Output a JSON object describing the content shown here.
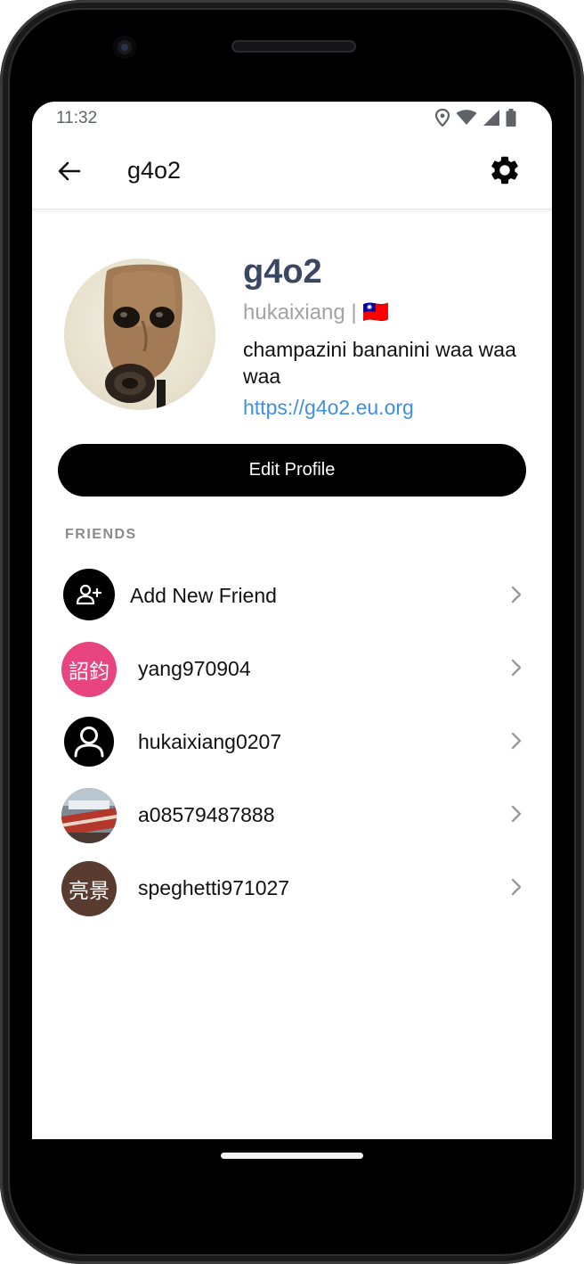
{
  "status_bar": {
    "time": "11:32",
    "icons": [
      "location-icon",
      "wifi-icon",
      "signal-icon",
      "battery-icon"
    ]
  },
  "app_bar": {
    "title": "g4o2",
    "back_icon": "arrow-left-icon",
    "settings_icon": "gear-icon"
  },
  "profile": {
    "display_name": "g4o2",
    "username": "hukaixiang",
    "separator": "|",
    "flag": "🇹🇼",
    "bio": "champazini bananini waa waa waa",
    "link": "https://g4o2.eu.org"
  },
  "edit_profile_label": "Edit Profile",
  "friends_section": {
    "title": "FRIENDS",
    "add_new": "Add New Friend",
    "items": [
      {
        "username": "yang970904",
        "avatar_text": "詔鈞",
        "avatar_color": "#e84480"
      },
      {
        "username": "hukaixiang0207",
        "avatar_text": "",
        "avatar_color": "#000000"
      },
      {
        "username": "a08579487888",
        "avatar_text": "",
        "avatar_color": "#8a6d60"
      },
      {
        "username": "speghetti971027",
        "avatar_text": "亮景",
        "avatar_color": "#5a3b30"
      }
    ]
  },
  "colors": {
    "name": "#3a4763",
    "link": "#3f8fe6",
    "button_bg": "#000000",
    "muted": "#a3a3a3"
  }
}
